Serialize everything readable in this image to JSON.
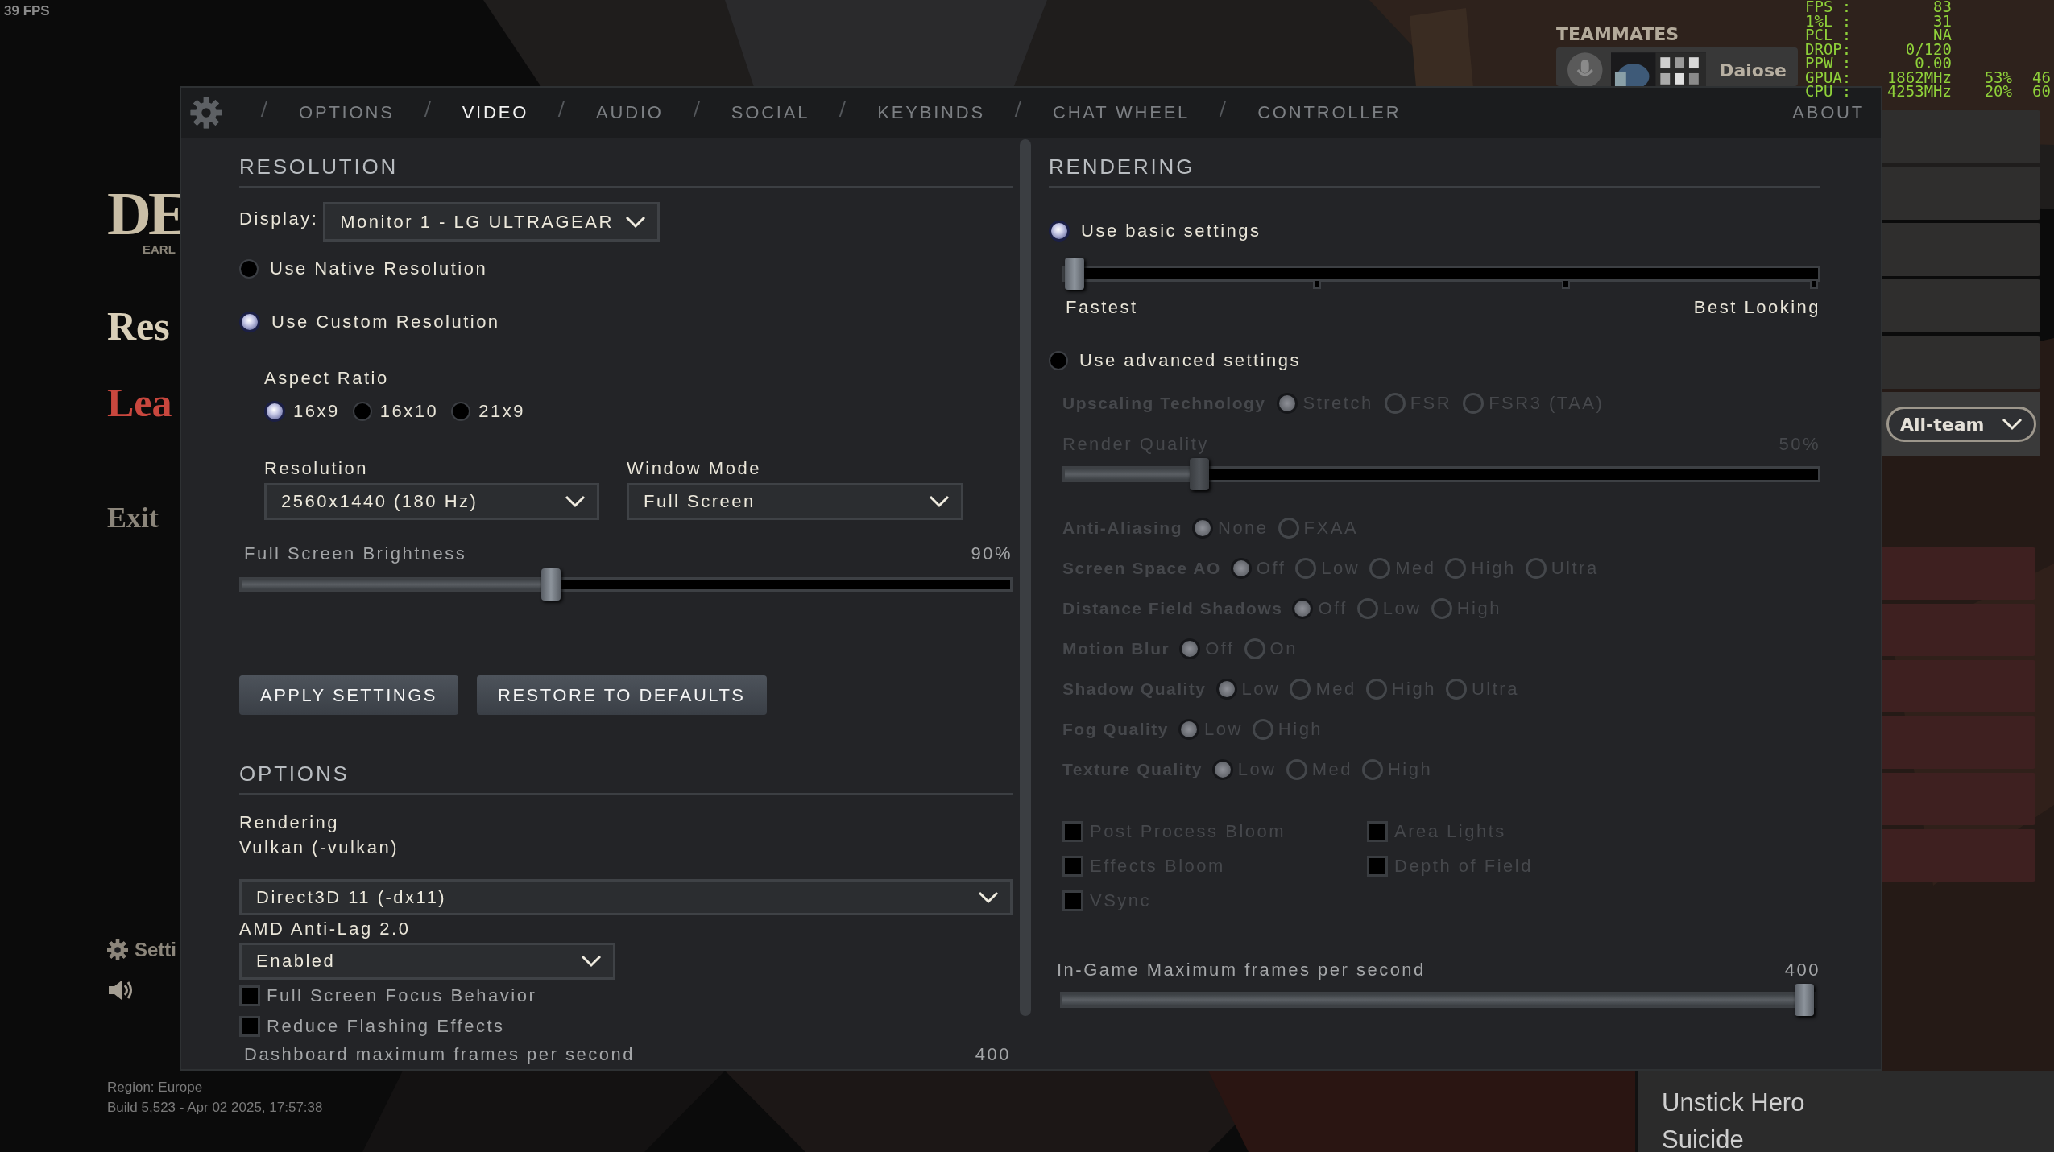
{
  "fps_counter": "39 FPS",
  "main_menu": {
    "logo": "DE",
    "logo_subtitle": "EARL",
    "items": [
      {
        "label": "Res",
        "kind": "primary"
      },
      {
        "label": "Lea",
        "kind": "danger"
      },
      {
        "label": "Exit",
        "kind": "secondary"
      }
    ],
    "settings_link": "Setti",
    "region": "Region: Europe",
    "build": "Build 5,523 - Apr 02 2025, 17:57:38"
  },
  "teammates": {
    "title": "TEAMMATES",
    "players": [
      {
        "name": "Daiose"
      }
    ]
  },
  "chat": {
    "channel": "All-team"
  },
  "context_menu": {
    "items": [
      "Unstick Hero",
      "Suicide"
    ]
  },
  "perf_overlay": {
    "rows": [
      {
        "label": "FPS :",
        "values": [
          "83"
        ]
      },
      {
        "label": "1%L :",
        "values": [
          "31"
        ]
      },
      {
        "label": "PCL :",
        "values": [
          "NA"
        ]
      },
      {
        "label": "DROP:",
        "values": [
          "0/120"
        ]
      },
      {
        "label": "PPW :",
        "values": [
          "0.00"
        ]
      },
      {
        "label": "GPUA:",
        "values": [
          "1862MHz",
          "53%",
          "46"
        ]
      },
      {
        "label": "CPU :",
        "values": [
          "4253MHz",
          "20%",
          "60"
        ]
      }
    ]
  },
  "settings": {
    "tabs": [
      {
        "label": "OPTIONS",
        "selected": false
      },
      {
        "label": "VIDEO",
        "selected": true
      },
      {
        "label": "AUDIO",
        "selected": false
      },
      {
        "label": "SOCIAL",
        "selected": false
      },
      {
        "label": "KEYBINDS",
        "selected": false
      },
      {
        "label": "CHAT WHEEL",
        "selected": false
      },
      {
        "label": "CONTROLLER",
        "selected": false
      },
      {
        "label": "ABOUT",
        "selected": false
      }
    ],
    "resolution": {
      "title": "RESOLUTION",
      "display_label": "Display:",
      "display": "Monitor 1 - LG ULTRAGEAR",
      "modes": [
        {
          "label": "Use Native Resolution",
          "selected": false
        },
        {
          "label": "Use Custom Resolution",
          "selected": true
        }
      ],
      "aspect_label": "Aspect Ratio",
      "aspects": [
        {
          "label": "16x9",
          "selected": true
        },
        {
          "label": "16x10",
          "selected": false
        },
        {
          "label": "21x9",
          "selected": false
        }
      ],
      "resolution_label": "Resolution",
      "resolution": "2560x1440 (180 Hz)",
      "window_mode_label": "Window Mode",
      "window_mode": "Full Screen",
      "brightness": {
        "label": "Full Screen Brightness",
        "reading": "90%",
        "level": 0.4
      },
      "buttons": [
        "APPLY SETTINGS",
        "RESTORE TO DEFAULTS"
      ]
    },
    "options": {
      "title": "OPTIONS",
      "rendering_label": "Rendering",
      "rendering_current": "Vulkan (-vulkan)",
      "rendering_api": "Direct3D 11 (-dx11)",
      "antilag_label": "AMD Anti-Lag 2.0",
      "antilag": "Enabled",
      "checkboxes": [
        {
          "label": "Full Screen Focus Behavior",
          "checked": false
        },
        {
          "label": "Reduce Flashing Effects",
          "checked": false
        }
      ],
      "dashboard_fps": {
        "label": "Dashboard maximum frames per second",
        "reading": "400"
      }
    },
    "rendering": {
      "title": "RENDERING",
      "presets": [
        {
          "label": "Use basic settings",
          "selected": true
        },
        {
          "label": "Use advanced settings",
          "selected": false
        }
      ],
      "quality": {
        "level": 0,
        "min_label": "Fastest",
        "max_label": "Best Looking"
      },
      "advanced": {
        "disabled": true,
        "upscaling": {
          "label": "Upscaling Technology",
          "options": [
            {
              "label": "Stretch",
              "selected": true
            },
            {
              "label": "FSR",
              "selected": false
            },
            {
              "label": "FSR3 (TAA)",
              "selected": false
            }
          ]
        },
        "render_quality": {
          "label": "Render Quality",
          "reading": "50%",
          "level": 0.17
        },
        "option_rows": [
          {
            "label": "Anti-Aliasing",
            "options": [
              {
                "label": "None",
                "selected": true
              },
              {
                "label": "FXAA",
                "selected": false
              }
            ]
          },
          {
            "label": "Screen Space AO",
            "options": [
              {
                "label": "Off",
                "selected": true
              },
              {
                "label": "Low",
                "selected": false
              },
              {
                "label": "Med",
                "selected": false
              },
              {
                "label": "High",
                "selected": false
              },
              {
                "label": "Ultra",
                "selected": false
              }
            ]
          },
          {
            "label": "Distance Field Shadows",
            "options": [
              {
                "label": "Off",
                "selected": true
              },
              {
                "label": "Low",
                "selected": false
              },
              {
                "label": "High",
                "selected": false
              }
            ]
          },
          {
            "label": "Motion Blur",
            "options": [
              {
                "label": "Off",
                "selected": true
              },
              {
                "label": "On",
                "selected": false
              }
            ]
          },
          {
            "label": "Shadow Quality",
            "options": [
              {
                "label": "Low",
                "selected": true
              },
              {
                "label": "Med",
                "selected": false
              },
              {
                "label": "High",
                "selected": false
              },
              {
                "label": "Ultra",
                "selected": false
              }
            ]
          },
          {
            "label": "Fog Quality",
            "options": [
              {
                "label": "Low",
                "selected": true
              },
              {
                "label": "High",
                "selected": false
              }
            ]
          },
          {
            "label": "Texture Quality",
            "options": [
              {
                "label": "Low",
                "selected": true
              },
              {
                "label": "Med",
                "selected": false
              },
              {
                "label": "High",
                "selected": false
              }
            ]
          }
        ],
        "checkboxes": [
          {
            "label": "Post Process Bloom",
            "checked": false
          },
          {
            "label": "Area Lights",
            "checked": false
          },
          {
            "label": "Effects Bloom",
            "checked": false
          },
          {
            "label": "Depth of Field",
            "checked": false
          },
          {
            "label": "VSync",
            "checked": false
          }
        ]
      },
      "max_fps": {
        "label": "In-Game Maximum frames per second",
        "reading": "400",
        "level": 1
      }
    }
  }
}
